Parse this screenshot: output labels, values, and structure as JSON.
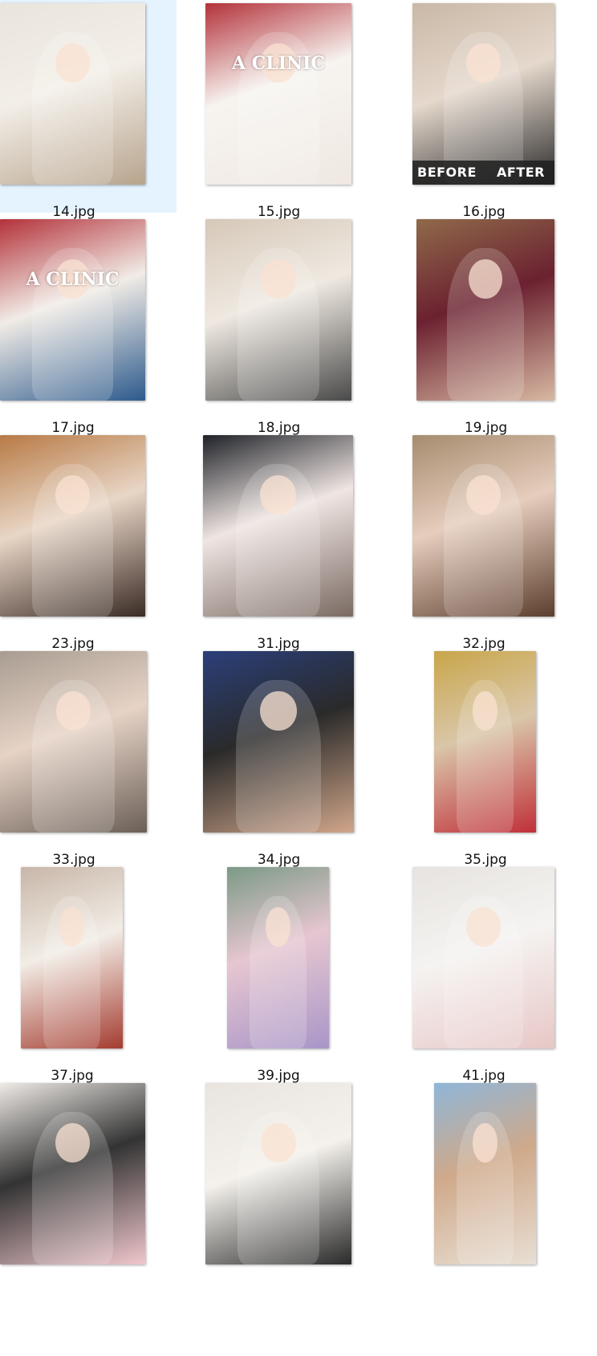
{
  "files": [
    {
      "name": "14.jpg",
      "selected": true,
      "colors": [
        "#e9e4dc",
        "#b7a48d",
        "#f3efe8"
      ]
    },
    {
      "name": "15.jpg",
      "selected": false,
      "colors": [
        "#b3323a",
        "#efe8e2",
        "#f7f4f0"
      ],
      "overlay": "A CLINIC"
    },
    {
      "name": "16.jpg",
      "selected": false,
      "colors": [
        "#c9b8a6",
        "#2a2a2a",
        "#e5d8cc"
      ],
      "overlay_left": "BEFORE",
      "overlay_right": "AFTER"
    },
    {
      "name": "17.jpg",
      "selected": false,
      "colors": [
        "#b3323a",
        "#2d5a8c",
        "#f1ece6"
      ],
      "overlay": "A CLINIC"
    },
    {
      "name": "18.jpg",
      "selected": false,
      "colors": [
        "#d6c8b8",
        "#4a4a4a",
        "#efe9e1"
      ]
    },
    {
      "name": "19.jpg",
      "selected": false,
      "colors": [
        "#8f6a4a",
        "#d8b8a2",
        "#6b2130"
      ]
    },
    {
      "name": "23.jpg",
      "selected": false,
      "colors": [
        "#b87a45",
        "#3a2b25",
        "#e8d6c6"
      ]
    },
    {
      "name": "31.jpg",
      "selected": false,
      "colors": [
        "#1f2228",
        "#7a6a62",
        "#efe5e2"
      ]
    },
    {
      "name": "32.jpg",
      "selected": false,
      "colors": [
        "#a68c6e",
        "#5c3e2e",
        "#e6cdbd"
      ]
    },
    {
      "name": "33.jpg",
      "selected": false,
      "colors": [
        "#a89c90",
        "#6b5f56",
        "#e6d3c6"
      ]
    },
    {
      "name": "34.jpg",
      "selected": false,
      "colors": [
        "#2b3f7a",
        "#d0a68a",
        "#2a2a2a"
      ]
    },
    {
      "name": "35.jpg",
      "selected": false,
      "colors": [
        "#c9a64a",
        "#c0303a",
        "#d9c6a8"
      ]
    },
    {
      "name": "37.jpg",
      "selected": false,
      "colors": [
        "#c8b6a8",
        "#a43c30",
        "#f2ede6"
      ]
    },
    {
      "name": "39.jpg",
      "selected": false,
      "colors": [
        "#7b9a86",
        "#a996c8",
        "#e6c6d0"
      ]
    },
    {
      "name": "41.jpg",
      "selected": false,
      "colors": [
        "#e6e3e0",
        "#e7c7c6",
        "#f5f3f1"
      ]
    },
    {
      "name": "",
      "selected": false,
      "colors": [
        "#efebe7",
        "#f0c7cc",
        "#333333"
      ]
    },
    {
      "name": "",
      "selected": false,
      "colors": [
        "#e9e4de",
        "#2a2a2a",
        "#f4f1ec"
      ]
    },
    {
      "name": "",
      "selected": false,
      "colors": [
        "#8fb6d8",
        "#e8dfd4",
        "#cfa98a"
      ]
    }
  ]
}
